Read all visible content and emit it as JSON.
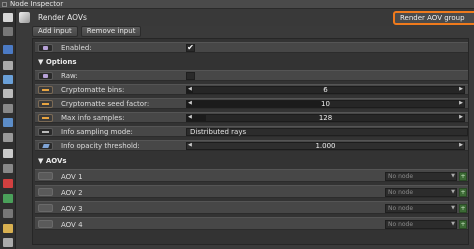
{
  "window": {
    "title": "Node Inspector"
  },
  "node": {
    "name": "Render AOVs",
    "group_select": "Render AOV group"
  },
  "buttons": {
    "add_input": "Add input",
    "remove_input": "Remove input"
  },
  "enabled": {
    "label": "Enabled:",
    "checked": true,
    "check_glyph": "✔"
  },
  "options": {
    "title": "Options",
    "raw": {
      "label": "Raw:",
      "checked": false
    },
    "bins": {
      "label": "Cryptomatte bins:",
      "value": "6",
      "fill_fraction": 0.02
    },
    "seed": {
      "label": "Cryptomatte seed factor:",
      "value": "10",
      "fill_fraction": 0.5
    },
    "max_info": {
      "label": "Max info samples:",
      "value": "128",
      "fill_fraction": 0.07
    },
    "sampling": {
      "label": "Info sampling mode:",
      "value": "Distributed rays"
    },
    "opacity": {
      "label": "Info opacity threshold:",
      "value": "1.000",
      "fill_fraction": 1.0
    }
  },
  "aovs": {
    "title": "AOVs",
    "items": [
      {
        "label": "AOV 1",
        "value": "No node"
      },
      {
        "label": "AOV 2",
        "value": "No node"
      },
      {
        "label": "AOV 3",
        "value": "No node"
      },
      {
        "label": "AOV 4",
        "value": "No node"
      }
    ],
    "plus_glyph": "+"
  },
  "colors": {
    "accent_outline": "#ef7a1c",
    "input_orange": "#e8a440",
    "plus_green": "#3c6a35"
  }
}
